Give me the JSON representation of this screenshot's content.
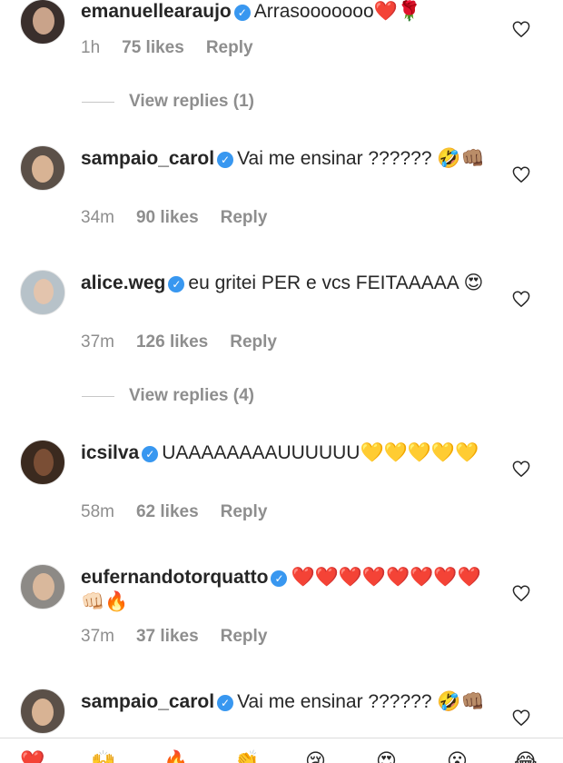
{
  "comments": [
    {
      "username": "emanuellearaujo",
      "text": "Arrasooooooo❤️🌹",
      "time": "1h",
      "likes": "75 likes",
      "reply": "Reply",
      "avatar_bg": "#3a2f2c",
      "avatar_face": "#c9a38a"
    },
    {
      "username": "sampaio_carol",
      "text": "Vai me ensinar ?????? 🤣👊🏽",
      "time": "34m",
      "likes": "90 likes",
      "reply": "Reply",
      "avatar_bg": "#5b5048",
      "avatar_face": "#d8b394"
    },
    {
      "username": "alice.weg",
      "text": "eu gritei PER e vcs FEITAAAAA 😍",
      "time": "37m",
      "likes": "126 likes",
      "reply": "Reply",
      "avatar_bg": "#b7c2c9",
      "avatar_face": "#e3c4ad"
    },
    {
      "username": "icsilva",
      "text": "UAAAAAAAAUUUUUU💛💛💛💛💛",
      "time": "58m",
      "likes": "62 likes",
      "reply": "Reply",
      "avatar_bg": "#3b2a1f",
      "avatar_face": "#7a4e35"
    },
    {
      "username": "eufernandotorquatto",
      "text": "❤️❤️❤️❤️❤️❤️❤️❤️👊🏻🔥",
      "time": "37m",
      "likes": "37 likes",
      "reply": "Reply",
      "avatar_bg": "#8d8a86",
      "avatar_face": "#d9b89c"
    },
    {
      "username": "sampaio_carol",
      "text": "Vai me ensinar ?????? 🤣👊🏽",
      "time": "",
      "likes": "",
      "reply": "",
      "avatar_bg": "#5b5048",
      "avatar_face": "#d8b394"
    }
  ],
  "view_replies": [
    {
      "label": "View replies (1)"
    },
    {
      "label": "View replies (4)"
    }
  ],
  "bottom_bar": {
    "emojis": [
      "❤️",
      "🙌",
      "🔥",
      "👏",
      "😢",
      "😍",
      "😮",
      "😂"
    ]
  },
  "colors": {
    "verified": "#3897f0",
    "meta": "#8e8e8e",
    "text": "#262626"
  }
}
